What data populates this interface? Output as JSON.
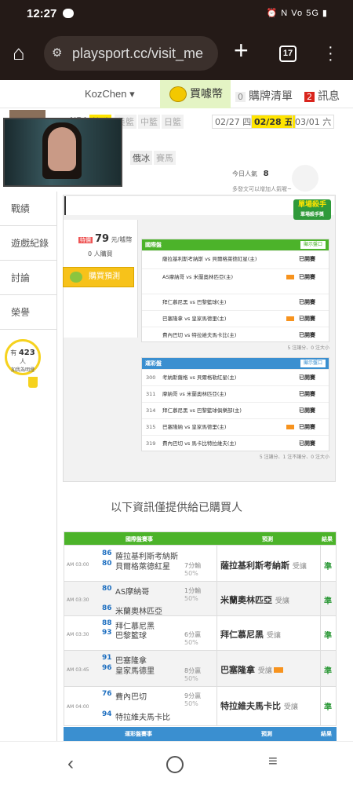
{
  "status": {
    "time": "12:27",
    "indicators": "⏰ N Vo 5G ▮"
  },
  "browser": {
    "url": "playsport.cc/visit_me",
    "tab_count": "17"
  },
  "header": {
    "user": "KozChen ▾",
    "buy_coins": "買噱幣",
    "cart_count": "0",
    "cart_label": "購牌清單",
    "msg_count": "2",
    "msg_label": "訊息"
  },
  "sports": [
    "NBA",
    "韓職",
    "美籃",
    "中籃",
    "日籃",
    "俄冰",
    "賽馬"
  ],
  "dates": [
    "02/27 四",
    "02/28 五",
    "03/01 六"
  ],
  "today": {
    "label": "今日人氣",
    "count": "8"
  },
  "hint": "多發文可以增加人氣喔~",
  "nav": [
    "戰績",
    "遊戲紀錄",
    "討論",
    "榮譽"
  ],
  "fans": {
    "prefix": "有",
    "count": "423",
    "suffix": "人",
    "sub": "加我為明燈"
  },
  "badge": {
    "line1": "單場殺手",
    "line2": "單場殺手獎"
  },
  "price": {
    "tag": "特價",
    "amount": "79",
    "unit": "元/噱幣"
  },
  "buyers": "0 人購買",
  "predict_btn": "購買預測",
  "table1": {
    "title": "國際盤",
    "btn": "顯示盤口",
    "rows": [
      {
        "teams": "薩拉基利斯考納斯 vs 貝爾格萊德紅星(主)",
        "res": "已開賽"
      },
      {
        "teams": "AS摩納哥 vs 米蘭奧林匹亞(主)",
        "res": "已開賽"
      },
      {
        "teams": "拜仁慕尼黑 vs 巴黎籃球(主)",
        "res": "已開賽"
      },
      {
        "teams": "巴塞隆拿 vs 皇家馬德里(主)",
        "res": "已開賽"
      },
      {
        "teams": "費內巴切 vs 特拉維夫馬卡比(主)",
        "res": "已開賽"
      }
    ],
    "footer": "5 注讓分、0 注大小"
  },
  "table2": {
    "title": "運彩盤",
    "btn": "顯示盤口",
    "rows": [
      {
        "num": "300",
        "teams": "考納斯薩格 vs 貝爾格勒紅星(主)",
        "res": "已開賽"
      },
      {
        "num": "311",
        "teams": "摩納哥 vs 米蘭奧林匹亞(主)",
        "res": "已開賽"
      },
      {
        "num": "314",
        "teams": "拜仁慕尼黑 vs 巴黎籃球俱樂部(主)",
        "res": "已開賽"
      },
      {
        "num": "315",
        "teams": "巴塞隆納 vs 皇家馬德里(主)",
        "res": "已開賽"
      },
      {
        "num": "319",
        "teams": "費內巴切 vs 馬卡比特拉維夫(主)",
        "res": "已開賽"
      }
    ],
    "footer": "5 注讓分、1 注不讓分、0 注大小"
  },
  "only_buyers": "以下資訊僅提供給已購買人",
  "results": {
    "headers": [
      "國際盤賽事",
      "預測",
      "結果"
    ],
    "rows": [
      {
        "time": "AM 03:00",
        "a_line": "86",
        "a_team": "薩拉基利斯考納斯",
        "b_line": "80",
        "b_team": "貝爾格萊德紅星",
        "spread": "7分輸",
        "pct": "50%",
        "pick": "薩拉基利斯考納斯",
        "pick_tag": "受讓",
        "ok": "準"
      },
      {
        "time": "AM 03:30",
        "a_line": "80",
        "a_team": "AS摩納哥",
        "b_line": "86",
        "b_team": "米蘭奧林匹亞",
        "spread": "1分輸",
        "pct": "50%",
        "pick": "米蘭奧林匹亞",
        "pick_tag": "受讓",
        "ok": "準"
      },
      {
        "time": "AM 03:30",
        "a_line": "88",
        "a_team": "拜仁慕尼黑",
        "b_line": "93",
        "b_team": "巴黎籃球",
        "spread": "6分贏",
        "pct": "50%",
        "pick": "拜仁慕尼黑",
        "pick_tag": "受讓",
        "ok": "準"
      },
      {
        "time": "AM 03:45",
        "a_line": "91",
        "a_team": "巴塞隆拿",
        "b_line": "96",
        "b_team": "皇家馬德里",
        "spread": "8分贏",
        "pct": "50%",
        "pick": "巴塞隆拿",
        "pick_tag": "受讓",
        "ok": "準"
      },
      {
        "time": "AM 04:00",
        "a_line": "76",
        "a_team": "費內巴切",
        "b_line": "94",
        "b_team": "特拉維夫馬卡比",
        "spread": "9分贏",
        "pct": "50%",
        "pick": "特拉維夫馬卡比",
        "pick_tag": "受讓",
        "ok": "準"
      }
    ]
  },
  "results2_headers": [
    "運彩盤賽事",
    "預測",
    "結果"
  ]
}
